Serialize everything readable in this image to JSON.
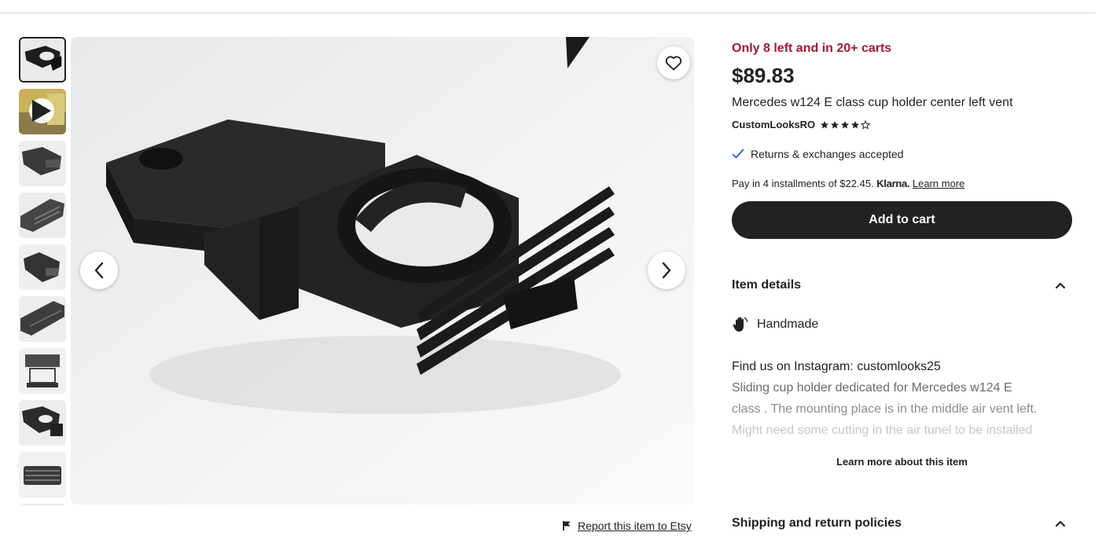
{
  "gallery": {
    "thumbnails": [
      {
        "type": "image",
        "active": true
      },
      {
        "type": "video",
        "active": false
      },
      {
        "type": "image",
        "active": false
      },
      {
        "type": "image",
        "active": false
      },
      {
        "type": "image",
        "active": false
      },
      {
        "type": "image",
        "active": false
      },
      {
        "type": "image",
        "active": false
      },
      {
        "type": "image",
        "active": false
      },
      {
        "type": "image",
        "active": false
      }
    ],
    "favorite_icon": "heart-icon",
    "prev_icon": "chevron-left-icon",
    "next_icon": "chevron-right-icon"
  },
  "report": {
    "label": "Report this item to Etsy",
    "icon": "flag-icon"
  },
  "listing": {
    "stock_notice": "Only 8 left and in 20+ carts",
    "price": "$89.83",
    "title": "Mercedes w124 E class cup holder center left vent",
    "seller": "CustomLooksRO",
    "rating_stars": 4,
    "rating_max": 5,
    "returns": "Returns & exchanges accepted",
    "installments_text": "Pay in 4 installments of $22.45.",
    "klarna": "Klarna.",
    "learn_more": "Learn more",
    "add_to_cart": "Add to cart"
  },
  "item_details": {
    "heading": "Item details",
    "handmade": "Handmade",
    "description": [
      "Find us on Instagram: customlooks25",
      "Sliding cup holder dedicated for Mercedes w124 E",
      "class . The mounting place is in the middle air vent left.",
      "Might need some cutting in the air tunel to be installed"
    ],
    "learn_more_item": "Learn more about this item"
  },
  "shipping": {
    "heading": "Shipping and return policies"
  },
  "colors": {
    "stock_red": "#a61a2e",
    "button_dark": "#222222",
    "check_blue": "#2f5dd6"
  }
}
